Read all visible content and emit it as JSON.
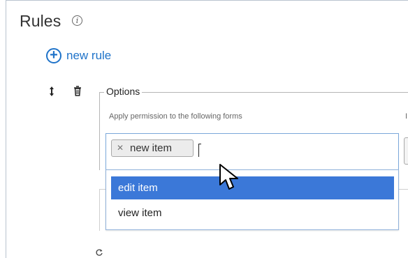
{
  "header": {
    "title": "Rules",
    "info_icon": "info-icon"
  },
  "actions": {
    "new_rule_label": "new rule",
    "new_rule_icon": "plus-circle-icon"
  },
  "rule": {
    "reorder_icon": "reorder-icon",
    "delete_icon": "trash-icon",
    "options": {
      "legend": "Options",
      "permission_label": "Apply permission to the following forms",
      "selected_tokens": [
        {
          "label": "new item",
          "remove_icon": "close-icon"
        }
      ],
      "dropdown_options": [
        {
          "label": "edit item",
          "selected": true
        },
        {
          "label": "view item",
          "selected": false
        }
      ]
    }
  },
  "cursor_icon": "mouse-pointer-icon",
  "bottom_icon": "refresh-icon",
  "colors": {
    "accent": "#1f73c9",
    "selected_background": "#3b78d8",
    "input_border": "#7aa7d9"
  }
}
